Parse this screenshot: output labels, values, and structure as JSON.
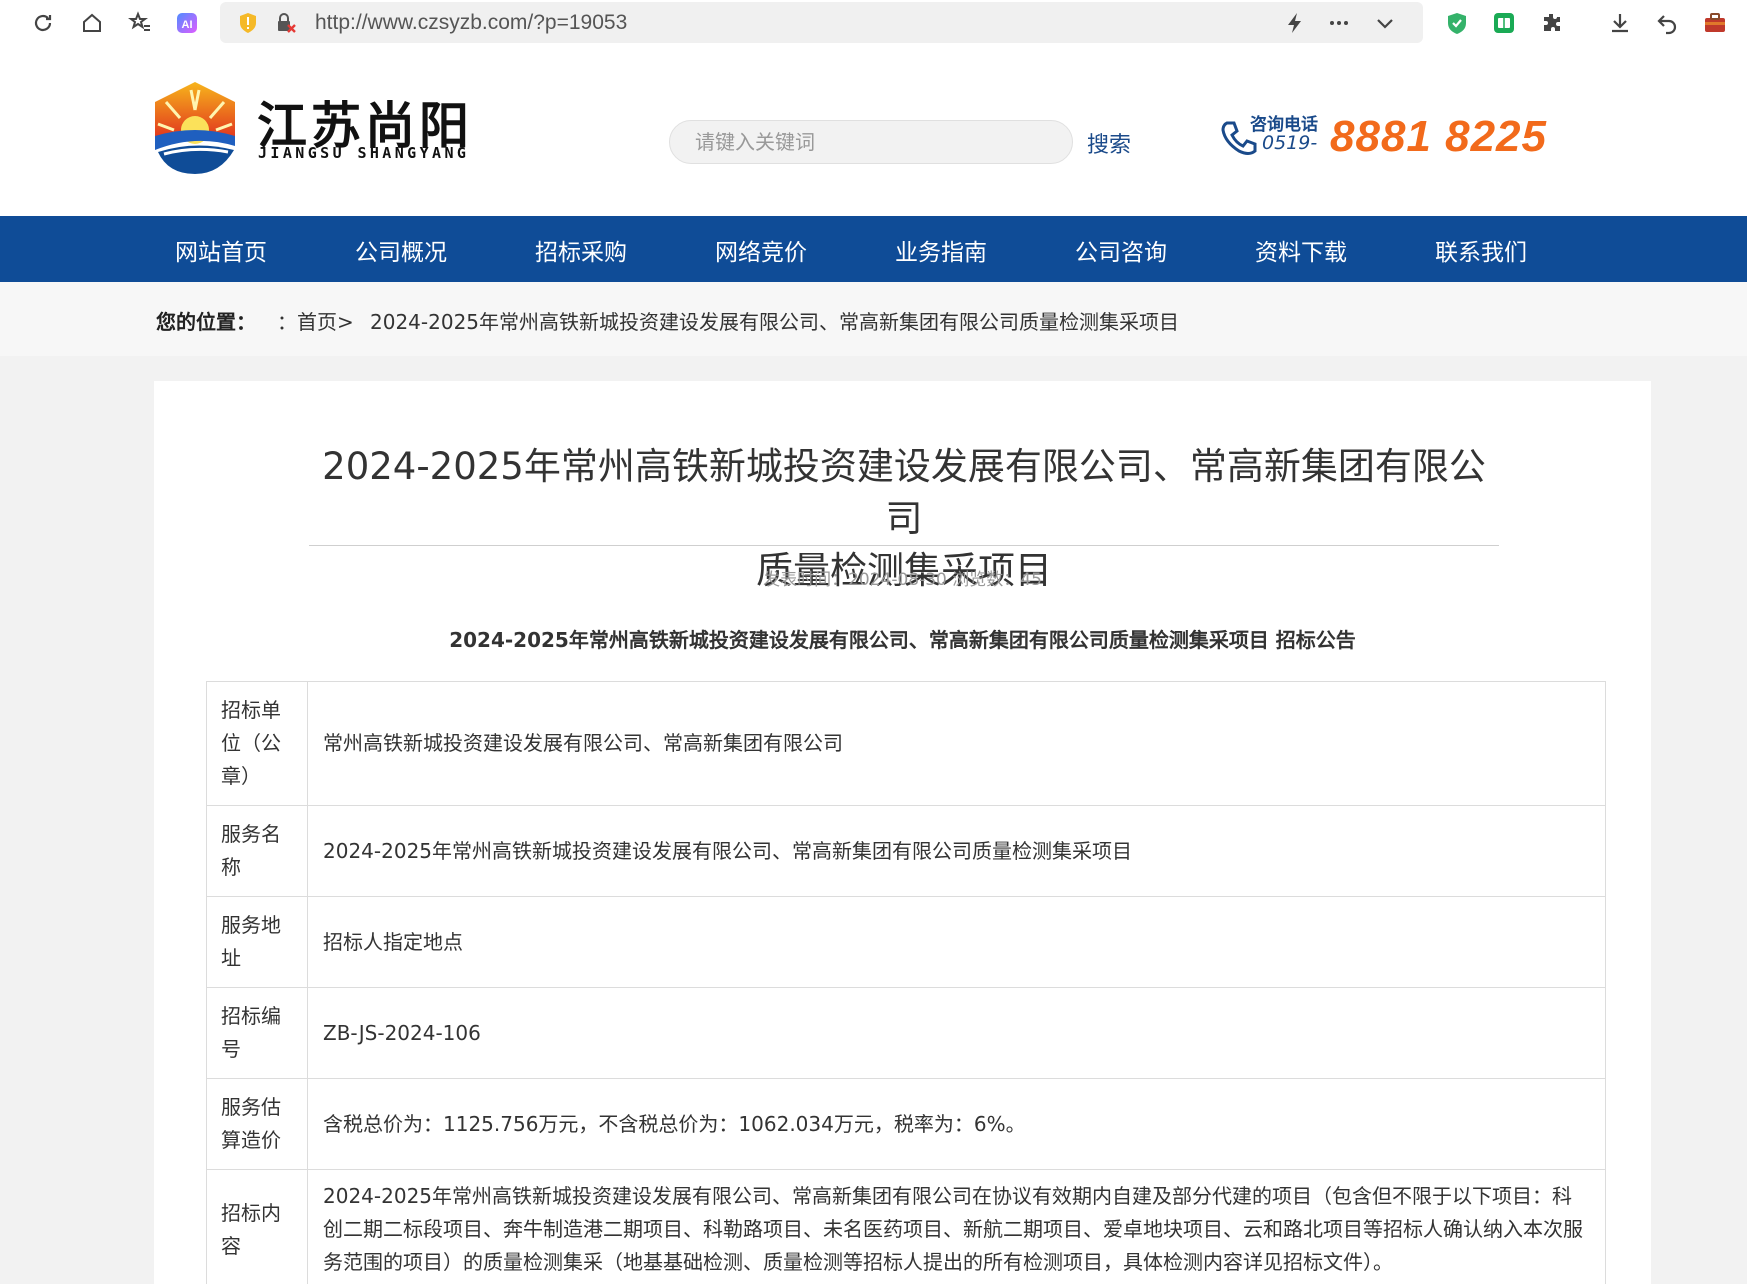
{
  "browser": {
    "url": "http://www.czsyzb.com/?p=19053"
  },
  "header": {
    "brand_cn": "江苏尚阳",
    "brand_en": "JIANGSU SHANGYANG",
    "search_placeholder": "请键入关键词",
    "search_button": "搜索",
    "phone_label": "咨询电话",
    "phone_prefix": "0519-",
    "phone_number": "8881 8225"
  },
  "nav": {
    "items": [
      "网站首页",
      "公司概况",
      "招标采购",
      "网络竞价",
      "业务指南",
      "公司咨询",
      "资料下载",
      "联系我们"
    ]
  },
  "breadcrumb": {
    "label": "您的位置：",
    "sep": "：",
    "home": "首页>",
    "current": "2024-2025年常州高铁新城投资建设发展有限公司、常高新集团有限公司质量检测集采项目"
  },
  "article": {
    "title_line1": "2024-2025年常州高铁新城投资建设发展有限公司、常高新集团有限公司",
    "title_line2": "质量检测集采项目",
    "meta": "发表时间：2024-08-30 浏览数：45",
    "subtitle": "2024-2025年常州高铁新城投资建设发展有限公司、常高新集团有限公司质量检测集采项目 招标公告"
  },
  "table": {
    "rows": [
      {
        "label": "招标单位（公章）",
        "value": "常州高铁新城投资建设发展有限公司、常高新集团有限公司"
      },
      {
        "label": "服务名称",
        "value": "2024-2025年常州高铁新城投资建设发展有限公司、常高新集团有限公司质量检测集采项目"
      },
      {
        "label": "服务地址",
        "value": "招标人指定地点"
      },
      {
        "label": "招标编号",
        "value": "ZB-JS-2024-106"
      },
      {
        "label": "服务估算造价",
        "value": "含税总价为：1125.756万元，不含税总价为：1062.034万元，税率为：6%。"
      },
      {
        "label": "招标内容",
        "value": "2024-2025年常州高铁新城投资建设发展有限公司、常高新集团有限公司在协议有效期内自建及部分代建的项目（包含但不限于以下项目：科创二期二标段项目、奔牛制造港二期项目、科勒路项目、未名医药项目、新航二期项目、爱卓地块项目、云和路北项目等招标人确认纳入本次服务范围的项目）的质量检测集采（地基基础检测、质量检测等招标人提出的所有检测项目，具体检测内容详见招标文件）。"
      }
    ]
  }
}
